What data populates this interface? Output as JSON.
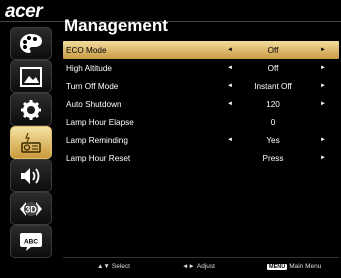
{
  "brand": "acer",
  "title": "Management",
  "sidebar": {
    "items": [
      {
        "icon": "palette-icon"
      },
      {
        "icon": "image-icon"
      },
      {
        "icon": "gear-icon"
      },
      {
        "icon": "projector-management-icon"
      },
      {
        "icon": "speaker-icon"
      },
      {
        "icon": "3d-icon"
      },
      {
        "icon": "language-abc-icon"
      }
    ],
    "active_index": 3
  },
  "rows": [
    {
      "label": "ECO Mode",
      "value": "Off",
      "arrow_left": "◄",
      "arrow_right": "►",
      "selected": true
    },
    {
      "label": "High Altitude",
      "value": "Off",
      "arrow_left": "◄",
      "arrow_right": "►"
    },
    {
      "label": "Turn Off Mode",
      "value": "Instant Off",
      "arrow_left": "◄",
      "arrow_right": "►"
    },
    {
      "label": "Auto Shutdown",
      "value": "120",
      "arrow_left": "◄",
      "arrow_right": "►"
    },
    {
      "label": "Lamp Hour Elapse",
      "value": "0"
    },
    {
      "label": "Lamp Reminding",
      "value": "Yes",
      "arrow_left": "◄",
      "arrow_right": "►"
    },
    {
      "label": "Lamp Hour Reset",
      "value": "Press",
      "arrow_right": "►"
    }
  ],
  "footer": {
    "select_symbol": "▲▼",
    "select_label": "Select",
    "adjust_symbol": "◄►",
    "adjust_label": "Adjust",
    "menu_key": "MENU",
    "menu_label": "Main Menu"
  },
  "colors": {
    "highlight_top": "#f2dc9f",
    "highlight_bottom": "#c89a42",
    "background": "#000000"
  }
}
